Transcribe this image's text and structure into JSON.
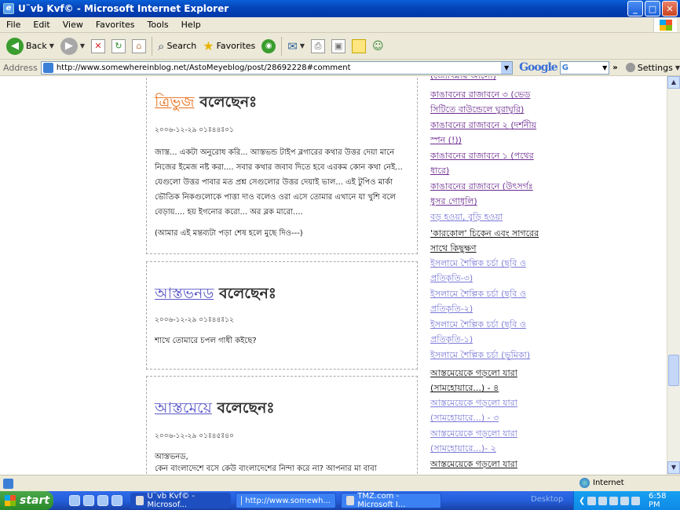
{
  "window": {
    "title": "U¨vb Kvf© - Microsoft Internet Explorer",
    "minimize": "_",
    "maximize": "□",
    "close": "✕"
  },
  "menu": [
    "File",
    "Edit",
    "View",
    "Favorites",
    "Tools",
    "Help"
  ],
  "toolbar": {
    "back": "Back",
    "search": "Search",
    "favorites": "Favorites"
  },
  "address": {
    "label": "Address",
    "url": "http://www.somewhereinblog.net/AstoMeyeblog/post/28692228#comment"
  },
  "google": {
    "brand": "Google",
    "field": "G",
    "settings": "Settings"
  },
  "comments": [
    {
      "author": "ত্রিভুজ",
      "verb": "বলেছেনঃ",
      "color": "#e86e1a",
      "date": "২০০৬-১২-২৯ ০১ঃ৪৪ঃ০১",
      "body": "জাস্ত... একটা অনুরোধ করি... আস্তভন্ড টাইপ ব্লগারের কথার উত্তর দেয়া মানে নিজের ইমেজ নষ্ট করা.... সবার কথার জবাব দিতে হবে এরকম কোন কথা নেই... যেগুলো উত্তর পাবার মত প্রশ্ন সেগুলোর উত্তর দেয়াই ভাল... এই টুপিও মার্কা ভৌতিক নিকগুলোকে পাত্তা দাও বলেও ওরা এসে তোমার এখানে যা খুশি বলে বেড়ায়.... হয় ইগনোর করো... অর ব্লক মারো....",
      "body2": "(আমার এই মন্তব্যটা পড়া শেষ হলে মুছে দিও---)"
    },
    {
      "author": "আস্তভনড",
      "verb": "বলেছেনঃ",
      "color": "#5a57c6",
      "date": "২০০৬-১২-২৯ ০১ঃ৪৪ঃ১২",
      "body": "শাখে তোমারে চপল গাধী কইছে?",
      "body2": ""
    },
    {
      "author": "আস্তমেয়ে",
      "verb": "বলেছেনঃ",
      "color": "#5a57c6",
      "date": "২০০৬-১২-২৯ ০১ঃ৪৫ঃ৪০",
      "body": "আস্তভনড,",
      "body2": "কেন বাংলাদেশে বসে কেউ বাংলাদেশের নিন্দা করে না? আপনার মা বাবা"
    }
  ],
  "sidebar": [
    {
      "text": "(জ্যোৎস্নায় আলো)",
      "color": "#6b2b8f"
    },
    {
      "text": "কাঙাবনের রাজাবনে ৩ (ভেড সিটিতে বাউন্ডেলে ঘুরাঘুরি)",
      "color": "#6b2b8f"
    },
    {
      "text": "কাঙাবনের রাজাবনে ২ (দর্শনীয় স্পন (!))",
      "color": "#6b2b8f"
    },
    {
      "text": "কাঙাবনের রাজাবনে ১ (পথের ধারে)",
      "color": "#6b2b8f"
    },
    {
      "text": "কাঙাবনের রাজাবনে (উৎসর্গঃ ধুসর গোধূলি)",
      "color": "#6b2b8f"
    },
    {
      "text": "বড় হওয়া, বুড়ি হওয়া",
      "color": "#7a78d6"
    },
    {
      "text": "'কারকোল' চিকেন এবং সাগরের সাথে কিছুক্ষণ",
      "color": "#111111"
    },
    {
      "text": "ইসলামে শৈল্পিক চর্চা (ছবি ও প্রতিকৃতি-৩)",
      "color": "#7a78d6"
    },
    {
      "text": "ইসলামে শৈল্পিক চর্চা (ছবি ও প্রতিকৃতি-২)",
      "color": "#7a78d6"
    },
    {
      "text": "ইসলামে শৈল্পিক চর্চা (ছবি ও প্রতিকৃতি-১)",
      "color": "#7a78d6"
    },
    {
      "text": "ইসলামে শৈল্পিক চর্চা (ভূমিকা)",
      "color": "#7a78d6"
    },
    {
      "text": "আস্তমেয়েকে গড়লো যারা (সামহোয়ারে...) - ৪",
      "color": "#111111"
    },
    {
      "text": "আস্তমেয়েকে গড়লো যারা (সামহোয়ারে...) - ৩",
      "color": "#7a78d6"
    },
    {
      "text": "আস্তমেয়েকে গড়লো যারা (সামহোয়ারে...)- ২",
      "color": "#7a78d6"
    },
    {
      "text": "আস্তমেয়েকে গড়লো যারা",
      "color": "#111111"
    }
  ],
  "status": {
    "zone": "Internet"
  },
  "taskbar": {
    "start": "start",
    "tasks": [
      "U¨vb Kvf© - Microsof...",
      "http://www.somewh...",
      "TMZ.com - Microsoft I..."
    ],
    "desktop": "Desktop",
    "time": "6:58 PM"
  }
}
